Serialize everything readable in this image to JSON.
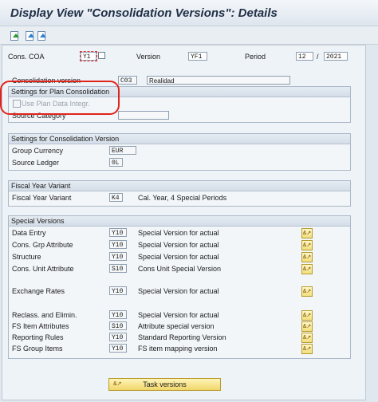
{
  "window": {
    "title": "Display View \"Consolidation Versions\": Details"
  },
  "toolbar": {
    "icons": [
      "other-entry-icon",
      "previous-entry-icon",
      "next-entry-icon"
    ]
  },
  "header": {
    "coa_label": "Cons. COA",
    "coa_value": "Y1",
    "version_label": "Version",
    "version_value": "YF1",
    "period_label": "Period",
    "period_value": "12",
    "period_sep": "/",
    "year_value": "2021"
  },
  "consolidation_version": {
    "label": "Consolidation version",
    "code": "C03",
    "desc": "Realidad"
  },
  "plan_settings": {
    "title": "Settings for Plan Consolidation",
    "checkbox_label": "Use Plan Data Integr.",
    "source_category_label": "Source Category",
    "source_category_value": ""
  },
  "cv_settings": {
    "title": "Settings for Consolidation Version",
    "group_currency_label": "Group Currency",
    "group_currency_value": "EUR",
    "source_ledger_label": "Source Ledger",
    "source_ledger_value": "0L"
  },
  "fiscal": {
    "title": "Fiscal Year Variant",
    "label": "Fiscal Year Variant",
    "value": "K4",
    "desc": "Cal. Year, 4 Special Periods"
  },
  "special": {
    "title": "Special Versions",
    "rows": [
      {
        "label": "Data Entry",
        "value": "Y10",
        "desc": "Special Version for actual"
      },
      {
        "label": "Cons. Grp Attribute",
        "value": "Y10",
        "desc": "Special Version for actual"
      },
      {
        "label": "Structure",
        "value": "Y10",
        "desc": "Special Version for actual"
      },
      {
        "label": "Cons. Unit Attribute",
        "value": "S10",
        "desc": "Cons Unit Special Version"
      },
      {
        "label": "Exchange Rates",
        "value": "Y10",
        "desc": "Special Version for actual"
      },
      {
        "label": "Reclass. and Elimin.",
        "value": "Y10",
        "desc": "Special Version for actual"
      },
      {
        "label": "FS Item Attributes",
        "value": "S10",
        "desc": "Attribute special version"
      },
      {
        "label": "Reporting Rules",
        "value": "Y10",
        "desc": "Standard Reporting Version"
      },
      {
        "label": "FS Group Items",
        "value": "Y10",
        "desc": "FS item mapping version"
      }
    ],
    "select_icon_glyph": "&↗"
  },
  "task_button": {
    "label": "Task versions",
    "icon": "&↗"
  }
}
